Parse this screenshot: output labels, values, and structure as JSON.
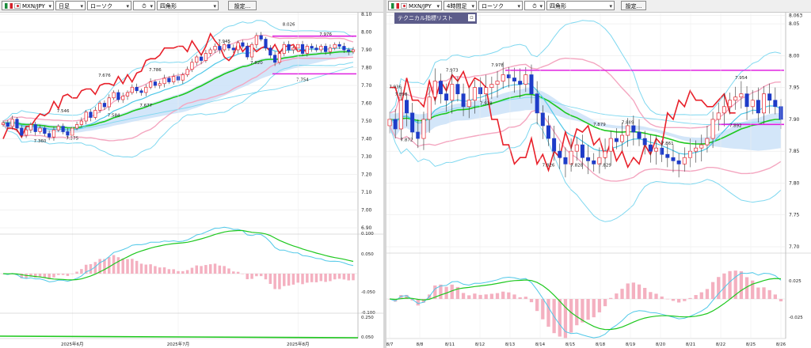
{
  "left_toolbar": {
    "pair": "MXN/JPY",
    "timeframe": "日足",
    "chart_type": "ローソク",
    "icon": "⏱",
    "style": "四角形",
    "settings": "設定..."
  },
  "right_toolbar": {
    "pair": "MXN/JPY",
    "timeframe": "4時間足",
    "chart_type": "ローソク",
    "icon": "⏱",
    "style": "四角形",
    "settings": "設定..."
  },
  "right_popup": {
    "label": "テクニカル指標リスト"
  },
  "colors": {
    "up": "#e8202a",
    "down": "#1e3cc8",
    "boll_outer": "#7fd8f0",
    "boll_inner": "#f4a6c0",
    "ema_fast": "#4fc8e8",
    "ema_slow": "#1ec81e",
    "chikou": "#e8202a",
    "cloud_blue": "#c8e0f8",
    "cloud_pink": "#f8cce0",
    "resistance": "#e020e0",
    "macd_hist": "#f4b0c0"
  },
  "chart_data": [
    {
      "type": "candlestick",
      "title": "MXN/JPY 日足",
      "ylim": [
        6.9,
        8.1
      ],
      "y_ticks": [
        "8.10",
        "8.00",
        "7.90",
        "7.80",
        "7.70",
        "7.60",
        "7.50",
        "7.40",
        "7.30",
        "7.20",
        "7.10",
        "7.00",
        "6.90"
      ],
      "x_ticks": [
        "2025年6月",
        "2025年7月",
        "2025年8月"
      ],
      "x_tick_index": [
        15,
        38,
        64
      ],
      "close": [
        7.49,
        7.47,
        7.51,
        7.46,
        7.42,
        7.45,
        7.48,
        7.44,
        7.46,
        7.43,
        7.41,
        7.45,
        7.47,
        7.44,
        7.42,
        7.46,
        7.48,
        7.5,
        7.55,
        7.52,
        7.56,
        7.6,
        7.58,
        7.63,
        7.66,
        7.62,
        7.64,
        7.66,
        7.69,
        7.67,
        7.66,
        7.69,
        7.72,
        7.7,
        7.71,
        7.74,
        7.72,
        7.75,
        7.73,
        7.76,
        7.79,
        7.83,
        7.86,
        7.84,
        7.88,
        7.9,
        7.92,
        7.9,
        7.93,
        7.91,
        7.9,
        7.94,
        7.92,
        7.86,
        7.93,
        7.98,
        7.96,
        7.91,
        7.87,
        7.83,
        7.88,
        7.93,
        7.9,
        7.91,
        7.93,
        7.88,
        7.92,
        7.91,
        7.9,
        7.92,
        7.89,
        7.91,
        7.93,
        7.92,
        7.9,
        7.89,
        7.9
      ],
      "price_labels": [
        {
          "text": "7.546",
          "i": 13,
          "y": 7.55
        },
        {
          "text": "7.360",
          "i": 8,
          "y": 7.38
        },
        {
          "text": "7.375",
          "i": 15,
          "y": 7.395
        },
        {
          "text": "7.584",
          "i": 24,
          "y": 7.525
        },
        {
          "text": "7.677",
          "i": 31,
          "y": 7.58
        },
        {
          "text": "7.676",
          "i": 22,
          "y": 7.75
        },
        {
          "text": "7.786",
          "i": 33,
          "y": 7.78
        },
        {
          "text": "7.945",
          "i": 48,
          "y": 7.94
        },
        {
          "text": "7.820",
          "i": 55,
          "y": 7.82
        },
        {
          "text": "8.026",
          "i": 62,
          "y": 8.035
        },
        {
          "text": "7.976",
          "i": 70,
          "y": 7.98
        },
        {
          "text": "7.754",
          "i": 65,
          "y": 7.725
        }
      ],
      "resistance": {
        "y1": 7.977,
        "y2": 7.765
      },
      "osc_labels": [
        "0.100",
        "0.050",
        "-0.050",
        "-0.100"
      ],
      "osc2_labels": [
        "0.250",
        "0.050"
      ]
    },
    {
      "type": "candlestick",
      "title": "MXN/JPY 4時間足",
      "ylim": [
        7.7,
        8.065
      ],
      "y_ticks": [
        "8.063",
        "8.05",
        "8.00",
        "7.95",
        "7.90",
        "7.85",
        "7.80",
        "7.75",
        "7.70"
      ],
      "x_ticks": [
        "8/7",
        "8/8",
        "8/11",
        "8/12",
        "8/13",
        "8/14",
        "8/15",
        "8/18",
        "8/19",
        "8/20",
        "8/21",
        "8/22",
        "8/25",
        "8/26"
      ],
      "close": [
        7.9,
        7.885,
        7.93,
        7.91,
        7.88,
        7.87,
        7.9,
        7.935,
        7.96,
        7.94,
        7.93,
        7.955,
        7.94,
        7.92,
        7.93,
        7.95,
        7.94,
        7.95,
        7.955,
        7.96,
        7.97,
        7.965,
        7.96,
        7.955,
        7.97,
        7.94,
        7.91,
        7.89,
        7.87,
        7.85,
        7.84,
        7.83,
        7.85,
        7.86,
        7.84,
        7.835,
        7.83,
        7.84,
        7.85,
        7.87,
        7.865,
        7.875,
        7.89,
        7.88,
        7.87,
        7.86,
        7.85,
        7.855,
        7.845,
        7.84,
        7.835,
        7.83,
        7.84,
        7.85,
        7.855,
        7.86,
        7.87,
        7.9,
        7.91,
        7.92,
        7.93,
        7.935,
        7.94,
        7.92,
        7.93,
        7.91,
        7.94,
        7.93,
        7.92,
        7.9
      ],
      "price_labels": [
        {
          "text": "7.936",
          "i": 1,
          "y": 7.949
        },
        {
          "text": "7.896",
          "i": 2,
          "y": 7.937
        },
        {
          "text": "7.973",
          "i": 11,
          "y": 7.975
        },
        {
          "text": "7.978",
          "i": 19,
          "y": 7.983
        },
        {
          "text": "7.918",
          "i": 17,
          "y": 7.923
        },
        {
          "text": "7.872",
          "i": 3,
          "y": 7.866
        },
        {
          "text": "7.826",
          "i": 28,
          "y": 7.826
        },
        {
          "text": "7.828",
          "i": 33,
          "y": 7.826
        },
        {
          "text": "7.829",
          "i": 38,
          "y": 7.826
        },
        {
          "text": "7.879",
          "i": 37,
          "y": 7.89
        },
        {
          "text": "7.889",
          "i": 42,
          "y": 7.893
        },
        {
          "text": "7.861",
          "i": 49,
          "y": 7.86
        },
        {
          "text": "7.954",
          "i": 62,
          "y": 7.963
        },
        {
          "text": "7.892",
          "i": 61,
          "y": 7.888
        }
      ],
      "resistance": {
        "y1": 7.977,
        "y2": 7.892
      },
      "osc_labels": [
        "0.025",
        "-0.025"
      ]
    }
  ]
}
